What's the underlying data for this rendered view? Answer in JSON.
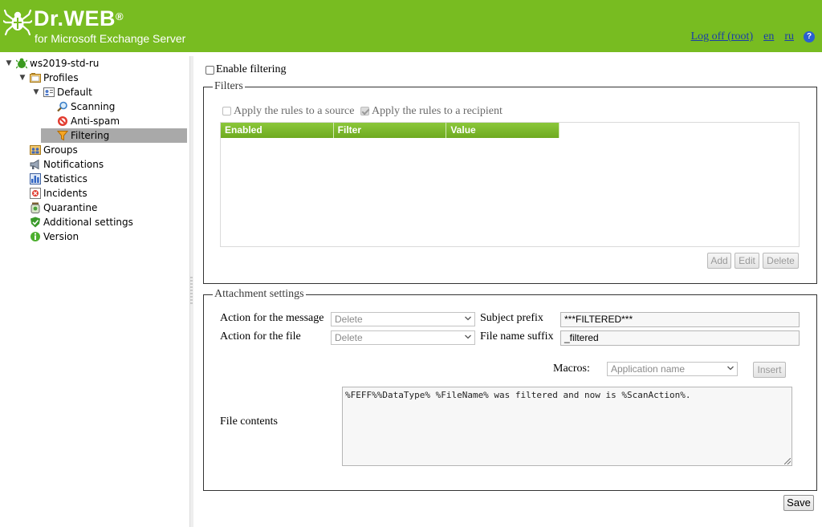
{
  "header": {
    "brand": "Dr.WEB",
    "brand_mark": "®",
    "product": "for Microsoft Exchange Server",
    "logoff_label": "Log off (root)",
    "lang_en": "en",
    "lang_ru": "ru",
    "help_glyph": "?",
    "background_color": "#78bc21"
  },
  "tree": {
    "root": "ws2019-std-ru",
    "profiles": "Profiles",
    "default": "Default",
    "scanning": "Scanning",
    "antispam": "Anti-spam",
    "filtering": "Filtering",
    "groups": "Groups",
    "notifications": "Notifications",
    "statistics": "Statistics",
    "incidents": "Incidents",
    "quarantine": "Quarantine",
    "additional": "Additional settings",
    "version": "Version"
  },
  "main": {
    "enable_filtering_label": "Enable filtering",
    "enable_filtering_checked": false,
    "filters": {
      "legend": "Filters",
      "apply_source_label": "Apply the rules to a source",
      "apply_source_checked": false,
      "apply_recipient_label": "Apply the rules to a recipient",
      "apply_recipient_checked": true,
      "columns": [
        "Enabled",
        "Filter",
        "Value"
      ],
      "add_label": "Add",
      "edit_label": "Edit",
      "delete_label": "Delete"
    },
    "attachment": {
      "legend": "Attachment settings",
      "action_message_label": "Action for the message",
      "action_message_value": "Delete",
      "action_file_label": "Action for the file",
      "action_file_value": "Delete",
      "subject_prefix_label": "Subject prefix",
      "subject_prefix_value": "***FILTERED***",
      "file_suffix_label": "File name suffix",
      "file_suffix_value": "_filtered",
      "macros_label": "Macros:",
      "macros_value": "Application name",
      "insert_label": "Insert",
      "file_contents_label": "File contents",
      "file_contents_value": "%FEFF%%DataType% %FileName% was filtered and now is %ScanAction%."
    },
    "save_label": "Save"
  }
}
